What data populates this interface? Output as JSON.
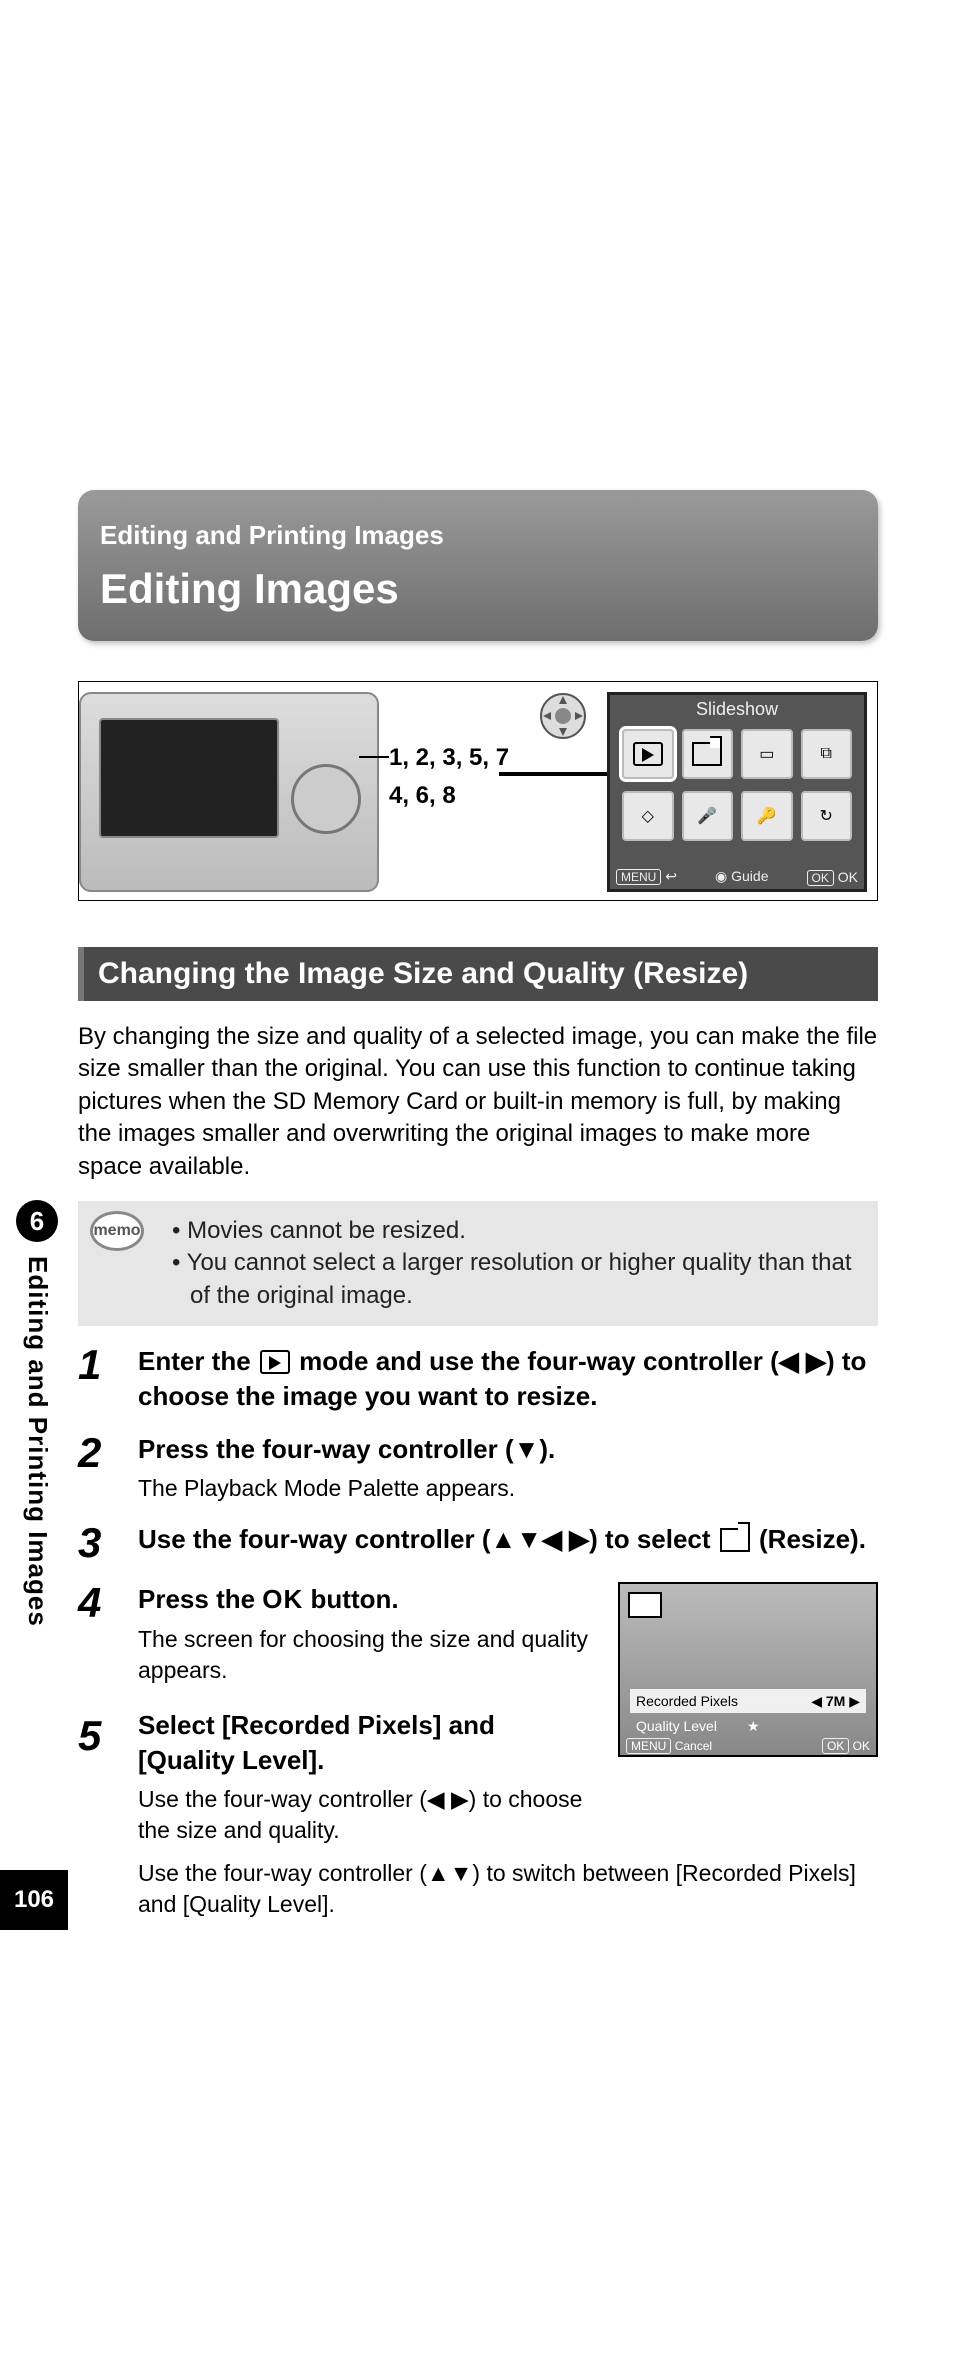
{
  "page_number": "106",
  "chapter": {
    "index": "6",
    "title": "Editing and Printing Images"
  },
  "header": {
    "breadcrumb": "Editing and Printing Images",
    "title": "Editing Images"
  },
  "diagram": {
    "callout_line1": "1, 2, 3, 5, 7",
    "callout_line2": "4, 6, 8",
    "lcd_title": "Slideshow",
    "lcd_menu": "MENU",
    "lcd_back_icon": "↩",
    "lcd_guide_icon": "◉",
    "lcd_guide": "Guide",
    "lcd_ok_btn": "OK",
    "lcd_ok": "OK"
  },
  "section_title": "Changing the Image Size and Quality (Resize)",
  "intro": "By changing the size and quality of a selected image, you can make the file size smaller than the original. You can use this function to continue taking pictures when the SD Memory Card or built-in memory is full, by making the images smaller and overwriting the original images to make more space available.",
  "memo": {
    "label": "memo",
    "items": [
      "Movies cannot be resized.",
      "You cannot select a larger resolution or higher quality than that of the original image."
    ]
  },
  "steps": {
    "s1": {
      "num": "1",
      "title_a": "Enter the ",
      "title_b": " mode and use the four-way controller (◀ ▶) to choose the image you want to resize."
    },
    "s2": {
      "num": "2",
      "title": "Press the four-way controller (▼).",
      "sub": "The Playback Mode Palette appears."
    },
    "s3": {
      "num": "3",
      "title_a": "Use the four-way controller (▲▼◀ ▶) to select ",
      "title_b": " (Resize)."
    },
    "s4": {
      "num": "4",
      "title_a": "Press the ",
      "ok": "OK",
      "title_b": " button.",
      "sub": "The screen for choosing the size and quality appears."
    },
    "s5": {
      "num": "5",
      "title": "Select [Recorded Pixels] and [Quality Level].",
      "sub1": "Use the four-way controller (◀ ▶) to choose the size and quality.",
      "sub2": "Use the four-way controller (▲▼) to switch between [Recorded Pixels] and [Quality Level]."
    }
  },
  "small_screen": {
    "row1_label": "Recorded Pixels",
    "row1_left": "◀",
    "row1_value": "7M",
    "row1_right": "▶",
    "row2_label": "Quality Level",
    "row2_value": "★",
    "menu": "MENU",
    "cancel": "Cancel",
    "ok_btn": "OK",
    "ok": "OK"
  }
}
